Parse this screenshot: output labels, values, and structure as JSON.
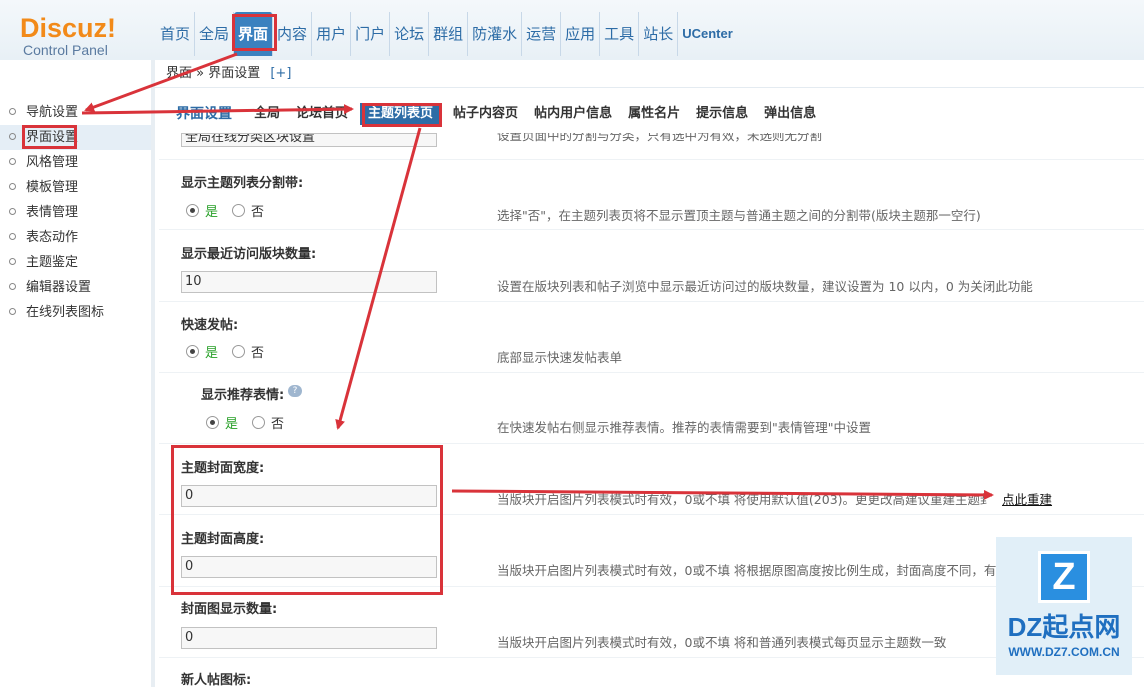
{
  "logo": {
    "brand": "Discuz!",
    "sub": "Control Panel"
  },
  "topnav": [
    "首页",
    "全局",
    "界面",
    "内容",
    "用户",
    "门户",
    "论坛",
    "群组",
    "防灌水",
    "运营",
    "应用",
    "工具",
    "站长",
    "UCenter"
  ],
  "topnav_active": "界面",
  "breadcrumb": {
    "path": "界面 » 界面设置",
    "plus": "[+]"
  },
  "sidebar": [
    "导航设置",
    "界面设置",
    "风格管理",
    "模板管理",
    "表情管理",
    "表态动作",
    "主题鉴定",
    "编辑器设置",
    "在线列表图标"
  ],
  "sidebar_active": "界面设置",
  "tabs": {
    "title": "界面设置",
    "items": [
      "全局",
      "论坛首页",
      "主题列表页",
      "帖子内容页",
      "帖内用户信息",
      "属性名片",
      "提示信息",
      "弹出信息"
    ],
    "active": "主题列表页"
  },
  "cut_top": {
    "input": "全局在线分类区块设置",
    "hint": "设置页面中的分割与分类，只有选中为有效，未选则无分割"
  },
  "separator": {
    "label": "显示主题列表分割带:",
    "yes": "是",
    "no": "否",
    "hint": "选择\"否\"，在主题列表页将不显示置顶主题与普通主题之间的分割带(版块主题那一空行)"
  },
  "recent_forums": {
    "label": "显示最近访问版块数量:",
    "value": "10",
    "hint": "设置在版块列表和帖子浏览中显示最近访问过的版块数量，建议设置为 10 以内，0 为关闭此功能"
  },
  "quick_post": {
    "label": "快速发帖:",
    "yes": "是",
    "no": "否",
    "hint": "底部显示快速发帖表单"
  },
  "smilies": {
    "label": "显示推荐表情:",
    "yes": "是",
    "no": "否",
    "hint": "在快速发帖右侧显示推荐表情。推荐的表情需要到\"表情管理\"中设置"
  },
  "cover_width": {
    "label": "主题封面宽度:",
    "value": "0",
    "hint": "当版块开启图片列表模式时有效，0或不填 将使用默认值(203)。更更改高建议重建主题封面，",
    "link": "点此重建"
  },
  "cover_height": {
    "label": "主题封面高度:",
    "value": "0",
    "hint": "当版块开启图片列表模式时有效，0或不填 将根据原图高度按比例生成，封面高度不同，有瀑布流的效果"
  },
  "cover_count": {
    "label": "封面图显示数量:",
    "value": "0",
    "hint": "当版块开启图片列表模式时有效，0或不填 将和普通列表模式每页显示主题数一致"
  },
  "new_icon": {
    "label": "新人帖图标:"
  },
  "watermark": {
    "logo": "Z",
    "name": "DZ起点网",
    "url": "WWW.DZ7.COM.CN"
  },
  "colors": {
    "accent": "#2d6ca6",
    "highlight": "#d9333a",
    "logo": "#f28a19"
  }
}
